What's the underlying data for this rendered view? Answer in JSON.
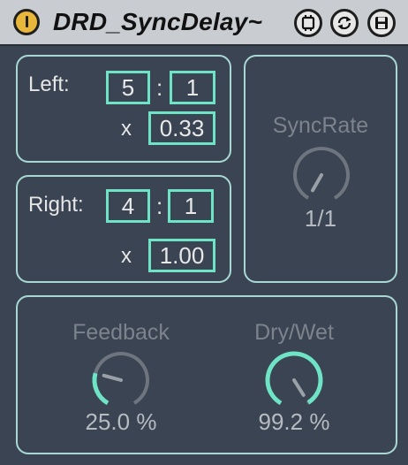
{
  "header": {
    "title": "DRD_SyncDelay~"
  },
  "left": {
    "label": "Left:",
    "numerator": "5",
    "separator": ":",
    "denominator": "1",
    "multiplier_label": "x",
    "multiplier": "0.33"
  },
  "right": {
    "label": "Right:",
    "numerator": "4",
    "separator": ":",
    "denominator": "1",
    "multiplier_label": "x",
    "multiplier": "1.00"
  },
  "syncrate": {
    "label": "SyncRate",
    "value": "1/1",
    "level": 0.0
  },
  "feedback": {
    "label": "Feedback",
    "value": "25.0 %",
    "level": 0.25
  },
  "drywet": {
    "label": "Dry/Wet",
    "value": "99.2 %",
    "level": 0.992
  },
  "colors": {
    "accent": "#6fe3c6",
    "panel_border": "#a9d8d4",
    "background": "#3a4452",
    "titlebar": "#c9ccd0",
    "power": "#e7b63a"
  },
  "icons": {
    "power": "power-icon",
    "freeze": "freeze-icon",
    "hotswap": "hotswap-icon",
    "save": "save-icon"
  }
}
